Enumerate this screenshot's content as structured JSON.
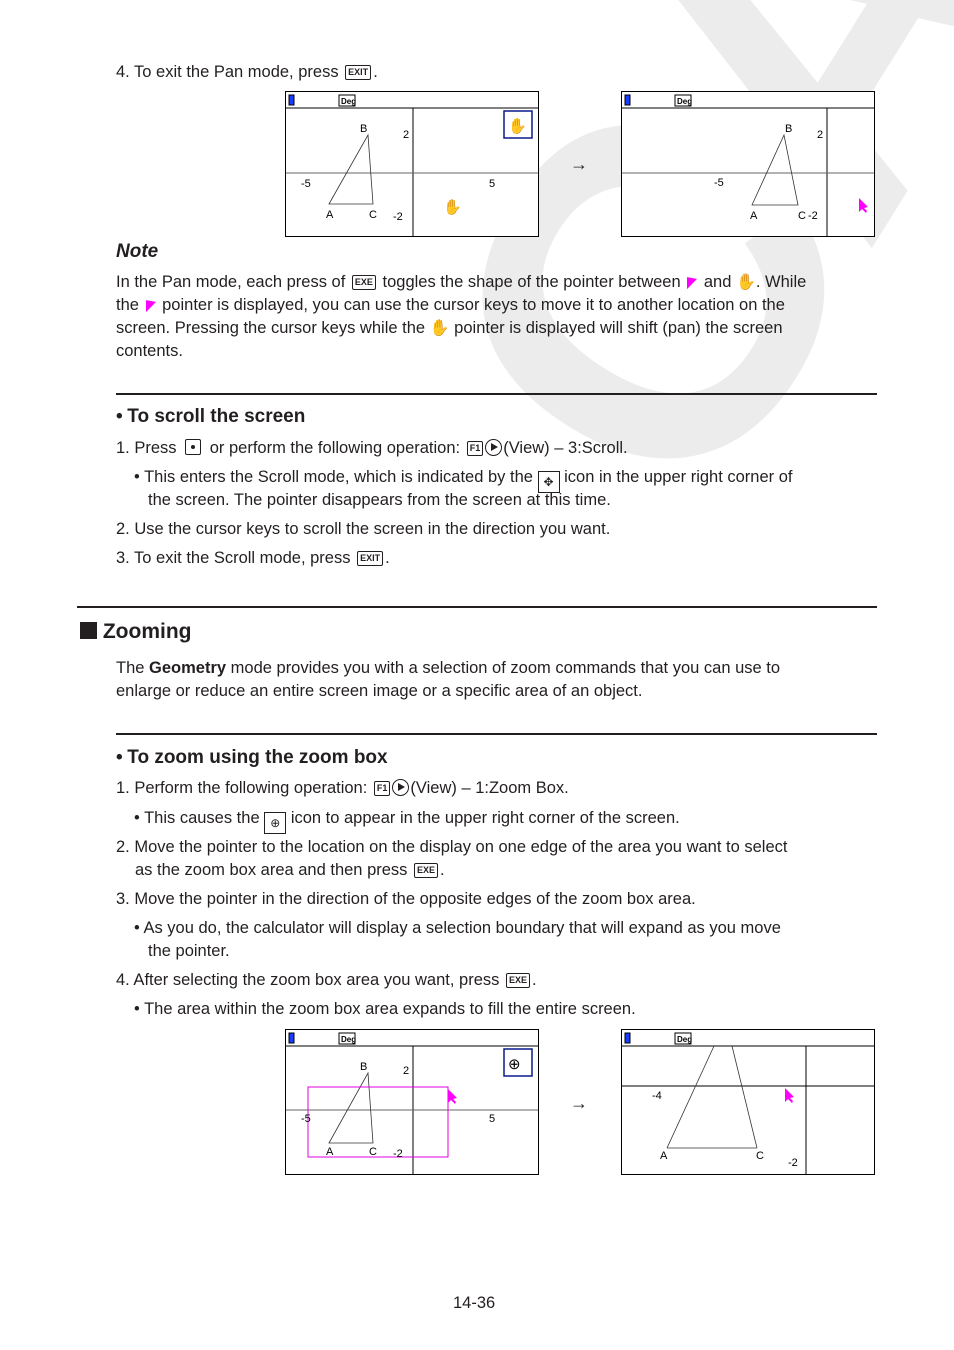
{
  "watermark": "CASIO",
  "pan_exit": {
    "step": "4. To exit the Pan mode, press",
    "key": "EXIT",
    "end": "."
  },
  "screens": {
    "status_label": "Deg",
    "pan_before": {
      "labels": {
        "A": "A",
        "B": "B",
        "C": "C",
        "x_neg": "-5",
        "x_pos": "5",
        "y_pos": "2",
        "y_neg": "-2"
      },
      "mode_icon": "pan-hand-icon",
      "pointer": "hand"
    },
    "pan_after": {
      "labels": {
        "A": "A",
        "B": "B",
        "C": "C",
        "x_neg": "-5",
        "y_pos": "2",
        "y_neg": "-2"
      },
      "pointer": "arrow"
    },
    "zoom_before": {
      "labels": {
        "A": "A",
        "B": "B",
        "C": "C",
        "x_neg": "-5",
        "x_pos": "5",
        "y_pos": "2",
        "y_neg": "-2"
      },
      "mode_icon": "zoom-box-icon",
      "pointer": "arrow"
    },
    "zoom_after": {
      "labels": {
        "A": "A",
        "C": "C",
        "x_neg": "-4",
        "y_neg": "-2"
      },
      "pointer": "arrow"
    },
    "arrow": "→"
  },
  "note": {
    "title": "Note",
    "p1_a": "In the Pan mode, each press of",
    "key_exe": "EXE",
    "p1_b": "toggles the shape of the pointer between",
    "p1_c": "and",
    "p1_d": ". While",
    "p2_a": "the",
    "p2_b": "pointer is displayed, you can use the cursor keys to move it to another location on the",
    "p3_a": "screen. Pressing the cursor keys while the",
    "p3_b": "pointer is displayed will shift (pan) the screen",
    "p4": "contents."
  },
  "scroll": {
    "heading": "To scroll the screen",
    "s1_a": "1. Press",
    "s1_b": "or perform the following operation:",
    "key_f1": "F1",
    "s1_c": "(View) – 3:Scroll.",
    "b1_a": "• This enters the Scroll mode, which is indicated by the",
    "b1_b": "icon in the upper right corner of",
    "b1_c": "the screen. The pointer disappears from the screen at this time.",
    "s2": "2. Use the cursor keys to scroll the screen in the direction you want.",
    "s3_a": "3. To exit the Scroll mode, press",
    "key_exit": "EXIT",
    "s3_b": "."
  },
  "zooming": {
    "heading": "Zooming",
    "intro_a": "The",
    "intro_bold": "Geometry",
    "intro_b": "mode provides you with a selection of zoom commands that you can use to",
    "intro_c": "enlarge or reduce an entire screen image or a specific area of an object."
  },
  "zoom_box": {
    "heading": "To zoom using the zoom box",
    "s1_a": "1. Perform the following operation:",
    "key_f1": "F1",
    "s1_b": "(View) – 1:Zoom Box.",
    "b1_a": "• This causes the",
    "b1_b": "icon to appear in the upper right corner of the screen.",
    "s2_a": "2. Move the pointer to the location on the display on one edge of the area you want to select",
    "s2_b": "as the zoom box area and then press",
    "key_exe": "EXE",
    "s2_c": ".",
    "s3": "3. Move the pointer in the direction of the opposite edges of the zoom box area.",
    "b3_a": "• As you do, the calculator will display a selection boundary that will expand as you move",
    "b3_b": "the pointer.",
    "s4_a": "4. After selecting the zoom box area you want, press",
    "s4_b": ".",
    "b4": "• The area within the zoom box area expands to fill the entire screen."
  },
  "page_number": "14-36"
}
